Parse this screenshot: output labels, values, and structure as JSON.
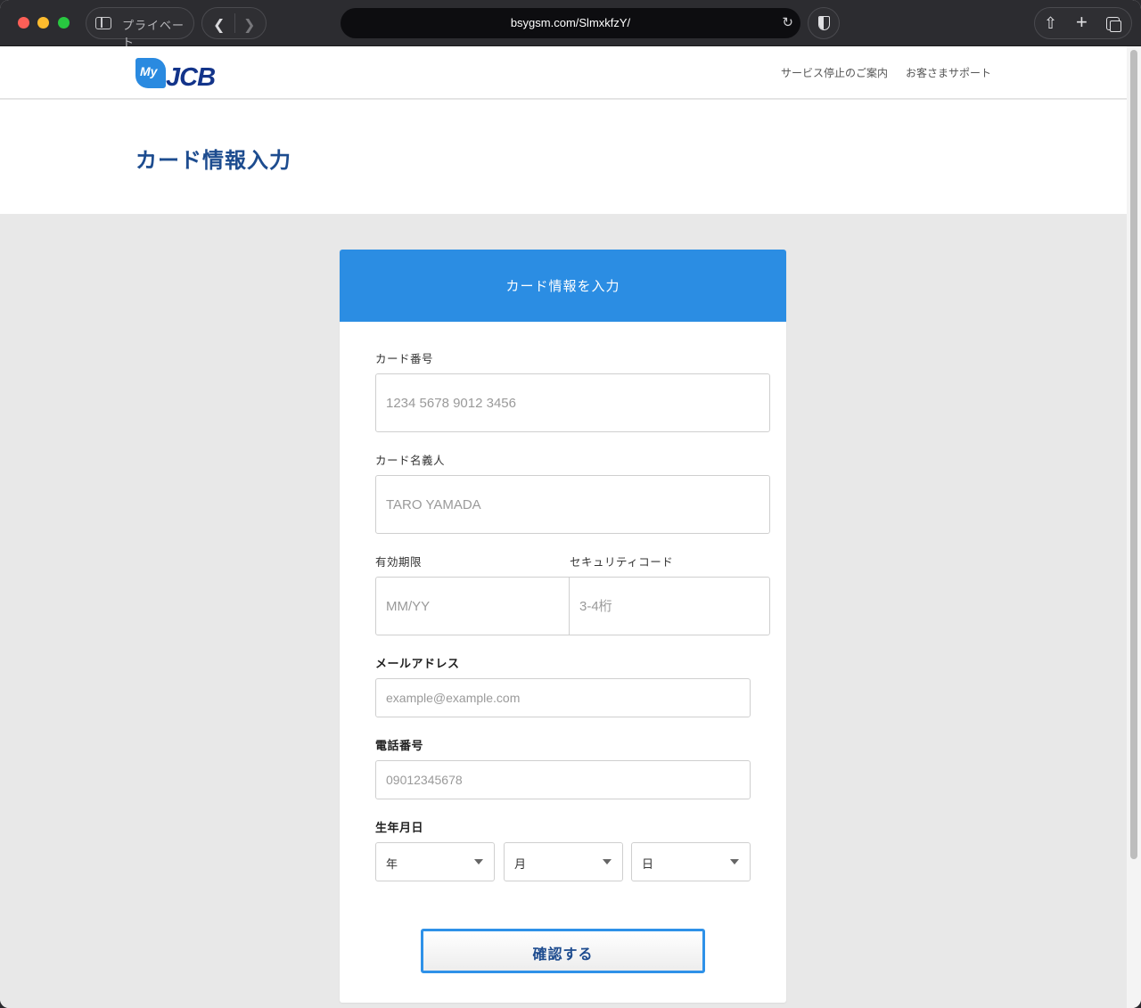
{
  "browser": {
    "sidebar_label": "プライベート",
    "url": "bsygsm.com/SlmxkfzY/"
  },
  "site": {
    "logo_my": "My",
    "logo_jcb": "JCB",
    "nav_links": [
      "サービス停止のご案内",
      "お客さまサポート"
    ],
    "page_title": "カード情報入力"
  },
  "form": {
    "header_title": "カード情報を入力",
    "card_number_label": "カード番号",
    "card_number_placeholder": "1234 5678 9012 3456",
    "card_name_label": "カード名義人",
    "card_name_placeholder": "TARO YAMADA",
    "expiry_label": "有効期限",
    "expiry_placeholder": "MM/YY",
    "cvv_label": "セキュリティコード",
    "cvv_placeholder": "3-4桁",
    "email_label": "メールアドレス",
    "email_placeholder": "example@example.com",
    "phone_label": "電話番号",
    "phone_placeholder": "09012345678",
    "birthdate_label": "生年月日",
    "birth_year": "年",
    "birth_month": "月",
    "birth_day": "日",
    "confirm_label": "確認する"
  },
  "colors": {
    "accent": "#2b8de3",
    "title_blue": "#1d4c8f",
    "jcb_navy": "#13348a"
  }
}
